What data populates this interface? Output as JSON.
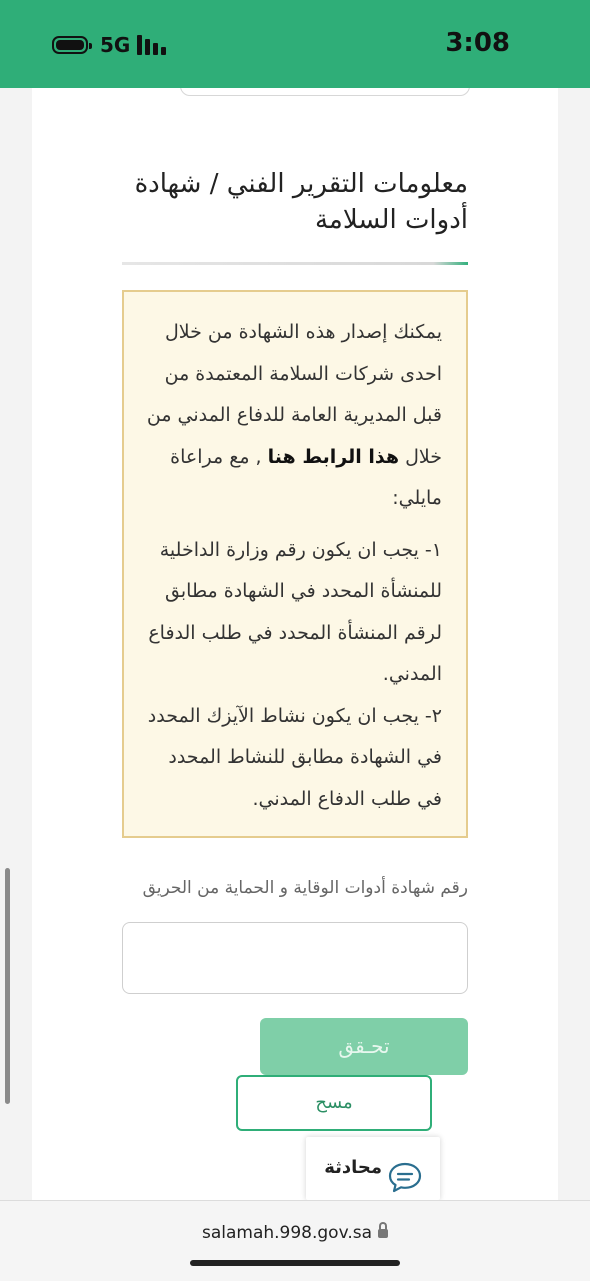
{
  "status_bar": {
    "network": "5G",
    "time": "3:08"
  },
  "section": {
    "title": "معلومات التقرير الفني / شهادة أدوات السلامة"
  },
  "info_box": {
    "intro_line_1": "يمكنك إصدار هذه الشهادة من خلال احدى شركات السلامة المعتمدة من قبل المديرية العامة للدفاع المدني من خلال",
    "link_text": "هذا الرابط هنا",
    "intro_line_2": " , مع مراعاة مايلي:",
    "rule_1": "١- يجب ان يكون رقم وزارة الداخلية للمنشأة المحدد في الشهادة مطابق لرقم المنشأة المحدد في طلب الدفاع المدني.",
    "rule_2": "٢- يجب ان يكون نشاط الآيزك المحدد في الشهادة مطابق للنشاط المحدد في طلب الدفاع المدني."
  },
  "form": {
    "cert_label": "رقم شهادة أدوات الوقاية و الحماية من الحريق",
    "cert_value": "",
    "verify_label": "تحـقق",
    "clear_label": "مسح"
  },
  "chat": {
    "label": "محادثة"
  },
  "browser": {
    "url": "salamah.998.gov.sa"
  }
}
